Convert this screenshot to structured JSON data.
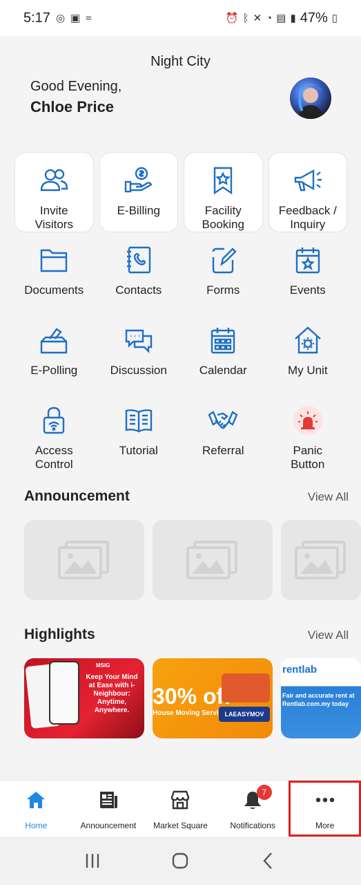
{
  "status_bar": {
    "time": "5:17",
    "battery": "47%",
    "left_icons": [
      "whatsapp-icon",
      "teams-icon",
      "sim-icon"
    ],
    "right_icons": [
      "alarm-icon",
      "bluetooth-icon",
      "mute-icon",
      "wifi-icon",
      "volte-icon",
      "signal-icon",
      "battery-icon"
    ]
  },
  "header": {
    "location": "Night City",
    "greeting": "Good Evening,",
    "user_name": "Chloe Price"
  },
  "grid": {
    "items": [
      {
        "label": "Invite\nVisitors",
        "icon": "invite-visitors-icon",
        "card": true
      },
      {
        "label": "E-Billing",
        "icon": "e-billing-icon",
        "card": true
      },
      {
        "label": "Facility\nBooking",
        "icon": "facility-booking-icon",
        "card": true
      },
      {
        "label": "Feedback /\nInquiry",
        "icon": "feedback-icon",
        "card": true
      },
      {
        "label": "Documents",
        "icon": "folder-icon",
        "card": false
      },
      {
        "label": "Contacts",
        "icon": "contacts-icon",
        "card": false
      },
      {
        "label": "Forms",
        "icon": "forms-icon",
        "card": false
      },
      {
        "label": "Events",
        "icon": "events-icon",
        "card": false
      },
      {
        "label": "E-Polling",
        "icon": "ballot-icon",
        "card": false
      },
      {
        "label": "Discussion",
        "icon": "discussion-icon",
        "card": false
      },
      {
        "label": "Calendar",
        "icon": "calendar-icon",
        "card": false
      },
      {
        "label": "My Unit",
        "icon": "house-gear-icon",
        "card": false
      },
      {
        "label": "Access\nControl",
        "icon": "access-control-icon",
        "card": false
      },
      {
        "label": "Tutorial",
        "icon": "book-icon",
        "card": false
      },
      {
        "label": "Referral",
        "icon": "handshake-icon",
        "card": false
      },
      {
        "label": "Panic\nButton",
        "icon": "siren-icon",
        "card": false
      }
    ]
  },
  "announcement": {
    "title": "Announcement",
    "view_all": "View All",
    "placeholder_icon": "image-placeholder-icon"
  },
  "highlights": {
    "title": "Highlights",
    "view_all": "View All",
    "cards": [
      {
        "headline": "Keep Your Mind at Ease with i-Neighbour: Anytime, Anywhere.",
        "brand": "MSIG"
      },
      {
        "headline": "30% off",
        "sub": "House Moving Service",
        "code": "LAEASYMOV"
      },
      {
        "headline": "rentlab",
        "sub": "Fair and accurate rent at Rentlab.com.my today"
      }
    ]
  },
  "bottom_nav": {
    "items": [
      {
        "label": "Home",
        "icon": "home-icon",
        "active": true
      },
      {
        "label": "Announcement",
        "icon": "newspaper-icon"
      },
      {
        "label": "Market Square",
        "icon": "store-icon"
      },
      {
        "label": "Notifications",
        "icon": "bell-icon",
        "badge": "7"
      },
      {
        "label": "More",
        "icon": "more-icon",
        "highlighted": true
      }
    ]
  },
  "colors": {
    "accent": "#1e88e5",
    "icon_blue": "#1f6fc4",
    "badge_red": "#e53935",
    "highlight_outline": "#e0201b"
  }
}
